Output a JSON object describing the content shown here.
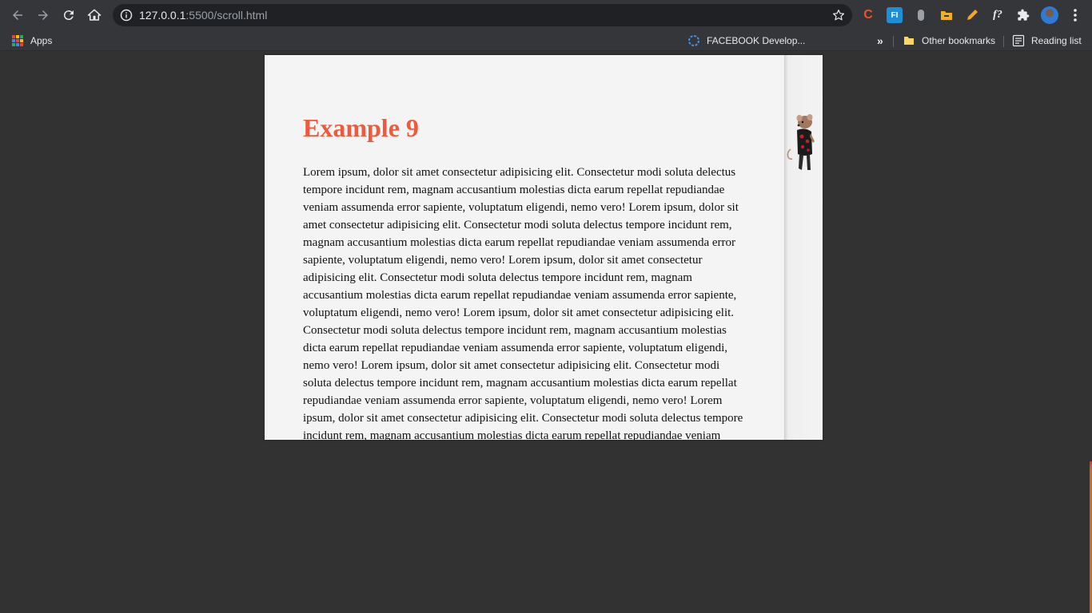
{
  "browser": {
    "url_host": "127.0.0.1",
    "url_rest": ":5500/scroll.html",
    "extensions": [
      {
        "name": "c-extension-icon",
        "label": "C",
        "color": "#e8542b"
      },
      {
        "name": "fi-extension-icon",
        "label": "FI",
        "color": "#1e8fd6"
      },
      {
        "name": "mouse-extension-icon",
        "label": "",
        "color": "#9aa0a6"
      },
      {
        "name": "folder-extension-icon",
        "label": "",
        "color": "#f2b11b"
      },
      {
        "name": "pencil-extension-icon",
        "label": "",
        "color": "#f5a623"
      },
      {
        "name": "formula-extension-icon",
        "label": "f?",
        "color": "#e8eaed"
      },
      {
        "name": "puzzle-extension-icon",
        "label": "",
        "color": "#e8eaed"
      }
    ]
  },
  "bookmarks": {
    "apps_label": "Apps",
    "facebook_label": "FACEBOOK Develop...",
    "overflow_label": "»",
    "other_label": "Other bookmarks",
    "reading_label": "Reading list"
  },
  "page": {
    "heading": "Example 9",
    "paragraph": "Lorem ipsum, dolor sit amet consectetur adipisicing elit. Consectetur modi soluta delectus tempore incidunt rem, magnam accusantium molestias dicta earum repellat repudiandae veniam assumenda error sapiente, voluptatum eligendi, nemo vero!",
    "paragraph_count": 6,
    "heading_color": "#f05a3c"
  }
}
